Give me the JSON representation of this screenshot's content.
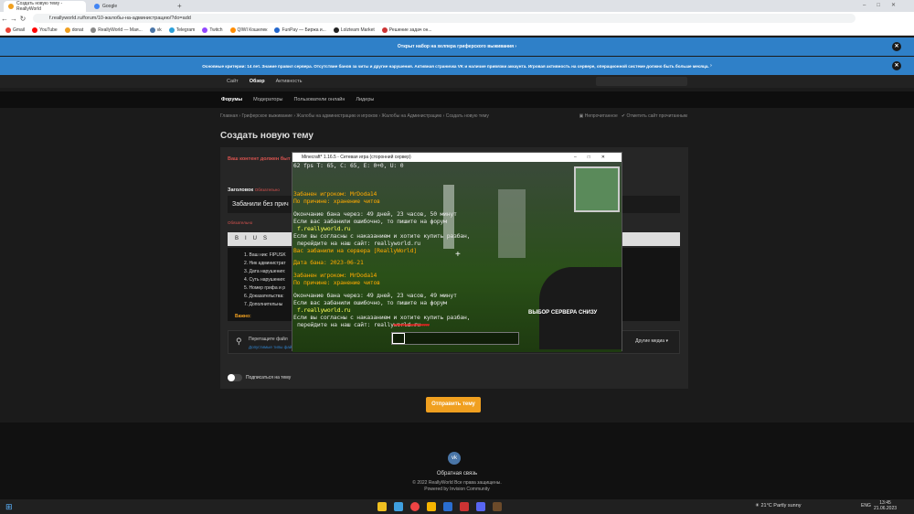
{
  "browser": {
    "tabs": [
      "Создать новую тему - ReallyWorld",
      "Google"
    ],
    "url": "f.reallyworld.ru/forum/10-жалобы-на-администрацию/?do=add",
    "bookmarks": [
      "Gmail",
      "YouTube",
      "donat",
      "ReallyWorld — Мая...",
      "vk",
      "Telegram",
      "Twitch",
      "QIWI Кошелек",
      "FunPay — Биржа и...",
      "Lolzteam Market",
      "Решение задач он..."
    ]
  },
  "banners": [
    "Открыт набор на хелпера гриферского выживания",
    "Основные критерии: 14 лет. Знание правил сервера. Отсутствие банов за читы и другие нарушения. Активная страничка VK и наличие привязки аккаунта. Игровая активность на сервере, операционной системе должно быть больше месяца."
  ],
  "nav": {
    "primary": [
      "Сайт",
      "Обзор",
      "Активность"
    ],
    "secondary": [
      "Форумы",
      "Модераторы",
      "Пользователи онлайн",
      "Лидеры"
    ]
  },
  "crumbs": "Главная  ›  Гриферское выживание  ›  Жалобы на администрацию и игроков  ›  Жалобы на Администрацию  ›  Создать новую тему",
  "crumbs_right": [
    "Непрочитанное",
    "Отметить сайт прочитанным"
  ],
  "page": {
    "title": "Создать новую тему",
    "warning": "Ваш контент должен быт",
    "field_label": "Заголовок",
    "field_required": "Обязательно",
    "title_value": "Забанили без прич",
    "content_label": "Обязательно",
    "list": [
      "1. Ваш ник: FIPUSK",
      "2. Ник администрат",
      "3. Дата нарушения:",
      "4. Суть нарушения:",
      "5. Номер грифа и р",
      "6. Доказательства:",
      "7. Дополнительны"
    ],
    "important": "Важно:",
    "attach": "Перетащите файл",
    "attach_sub": "Допустимые типы файлов",
    "other_media": "Другие медиа",
    "subscribe": "Подписаться на тему",
    "submit": "Отправить тему"
  },
  "footer": {
    "feedback": "Обратная связь",
    "copyright": "© 2022 ReallyWorld Все права защищены.",
    "powered": "Powered by Invision Community"
  },
  "minecraft": {
    "title": "Minecraft* 1.16.5 - Сетевая игра (сторонний сервер)",
    "hud": "62 fps T: 65, C: 65, E: 0+0, U: 0",
    "lines": [
      {
        "t": "Забанен игроком: MrDoda14",
        "c": "o"
      },
      {
        "t": "По причине: хранение читов",
        "c": "o"
      },
      {
        "t": "Окончание бана через: 49 дней, 23 часов, 50 минут",
        "c": "w"
      },
      {
        "t": "Если вас забанили ошибочно, то пишите на форум",
        "c": "w"
      },
      {
        "t": "f.reallyworld.ru",
        "c": "y"
      },
      {
        "t": "Если вы согласны с наказанием и хотите купить разбан,",
        "c": "w"
      },
      {
        "t": "перейдите на наш сайт: reallyworld.ru",
        "c": "w"
      },
      {
        "t": "Вас забанили на сервера [ReallyWorld]",
        "c": "o"
      },
      {
        "t": "Дата бана: 2023-06-21",
        "c": "o"
      },
      {
        "t": "Забанен игроком: MrDoda14",
        "c": "o"
      },
      {
        "t": "По причине: хранение читов",
        "c": "o"
      },
      {
        "t": "Окончание бана через: 49 дней, 23 часов, 49 минут",
        "c": "w"
      },
      {
        "t": "Если вас забанили ошибочно, то пишите на форум",
        "c": "w"
      },
      {
        "t": "f.reallyworld.ru",
        "c": "y"
      },
      {
        "t": "Если вы согласны с наказанием и хотите купить разбан,",
        "c": "w"
      },
      {
        "t": "перейдите на наш сайт: reallyworld.ru",
        "c": "w"
      }
    ],
    "overlay": "ВЫБОР СЕРВЕРА СНИЗУ"
  },
  "taskbar": {
    "weather": "21°C  Partly sunny",
    "lang": "ENG",
    "time": "13:45",
    "date": "21.06.2023"
  }
}
